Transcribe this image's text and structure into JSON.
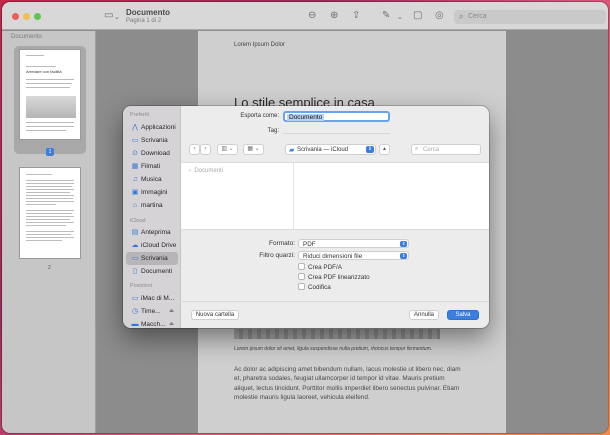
{
  "window": {
    "title": "Documento",
    "subtitle": "Pagina 1 di 2",
    "search_placeholder": "Cerca"
  },
  "sidebar": {
    "title": "Documento",
    "thumb1_heading": "Arredare con facilità",
    "page1_badge": "1",
    "page2_label": "2"
  },
  "page": {
    "header": "Lorem Ipsum Dolor",
    "title": "Lo stile semplice in casa",
    "caption": "Lorem ipsum dolor sit amet, ligula suspendisse nulla pretium, rhoncus tempor fermentum.",
    "body": "Ac dolor ac adipiscing amet bibendum nullam, lacus molestie ut libero nec, diam et, pharetra sodales, feugiat ullamcorper id tempor id vitae. Mauris pretium aliquet, lectus tincidunt. Porttitor mollis imperdiet libero senectus pulvinar. Etiam molestie mauris ligula laoreet, vehicula eleifend."
  },
  "dialog": {
    "sidebar": {
      "favorites_title": "Preferiti",
      "favorites": [
        {
          "label": "Applicazioni",
          "icon": "apps-icon"
        },
        {
          "label": "Scrivania",
          "icon": "desktop-icon"
        },
        {
          "label": "Download",
          "icon": "download-icon"
        },
        {
          "label": "Filmati",
          "icon": "movies-icon"
        },
        {
          "label": "Musica",
          "icon": "music-icon"
        },
        {
          "label": "Immagini",
          "icon": "pictures-icon"
        },
        {
          "label": "martina",
          "icon": "home-icon"
        }
      ],
      "icloud_title": "iCloud",
      "icloud": [
        {
          "label": "Anteprima",
          "icon": "preview-icon"
        },
        {
          "label": "iCloud Drive",
          "icon": "cloud-icon"
        },
        {
          "label": "Scrivania",
          "icon": "desktop-icon"
        },
        {
          "label": "Documenti",
          "icon": "documents-icon"
        }
      ],
      "locations_title": "Posizioni",
      "locations": [
        {
          "label": "iMac di M...",
          "icon": "imac-icon"
        },
        {
          "label": "Time...",
          "icon": "timemachine-icon"
        },
        {
          "label": "Macch...",
          "icon": "disk-icon"
        }
      ]
    },
    "export_label": "Esporta come:",
    "file_name": "Documento",
    "tags_label": "Tag:",
    "location": "Scrivania — iCloud",
    "search_placeholder": "Cerca",
    "browser_item": "Documenti",
    "format_label": "Formato:",
    "format_value": "PDF",
    "filter_label": "Filtro quarzi:",
    "filter_value": "Riduci dimensioni file",
    "checkboxes": [
      "Crea PDF/A",
      "Crea PDF linearizzato",
      "Codifica"
    ],
    "new_folder": "Nuova cartella",
    "cancel": "Annulla",
    "save": "Salva"
  },
  "colors": {
    "accent": "#3b7ee0",
    "window_bg": "#8e8e8e"
  }
}
